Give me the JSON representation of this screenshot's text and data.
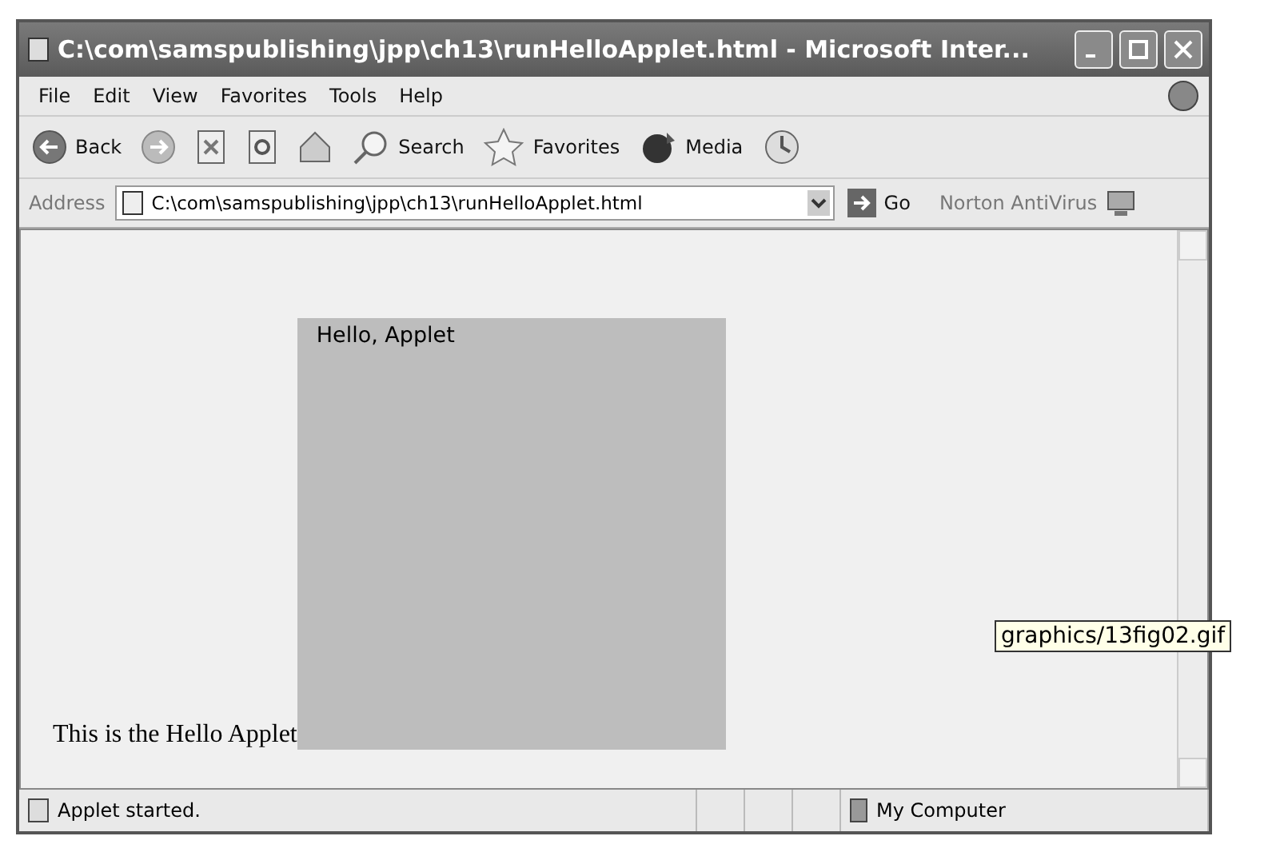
{
  "window": {
    "title": "C:\\com\\samspublishing\\jpp\\ch13\\runHelloApplet.html - Microsoft Inter..."
  },
  "menu": [
    "File",
    "Edit",
    "View",
    "Favorites",
    "Tools",
    "Help"
  ],
  "toolbar": [
    {
      "kind": "back",
      "label": "Back"
    },
    {
      "kind": "forward"
    },
    {
      "kind": "stop"
    },
    {
      "kind": "refresh"
    },
    {
      "kind": "home"
    },
    {
      "kind": "search",
      "label": "Search"
    },
    {
      "kind": "favorites",
      "label": "Favorites"
    },
    {
      "kind": "media",
      "label": "Media"
    },
    {
      "kind": "history"
    }
  ],
  "address": {
    "label": "Address",
    "value": "C:\\com\\samspublishing\\jpp\\ch13\\runHelloApplet.html",
    "go": "Go",
    "norton": "Norton AntiVirus"
  },
  "page": {
    "applet_text": "Hello, Applet",
    "body_text": "This is the Hello Applet"
  },
  "tooltip": "graphics/13fig02.gif",
  "status_bar": {
    "text": "Applet started.",
    "zone": "My Computer"
  }
}
